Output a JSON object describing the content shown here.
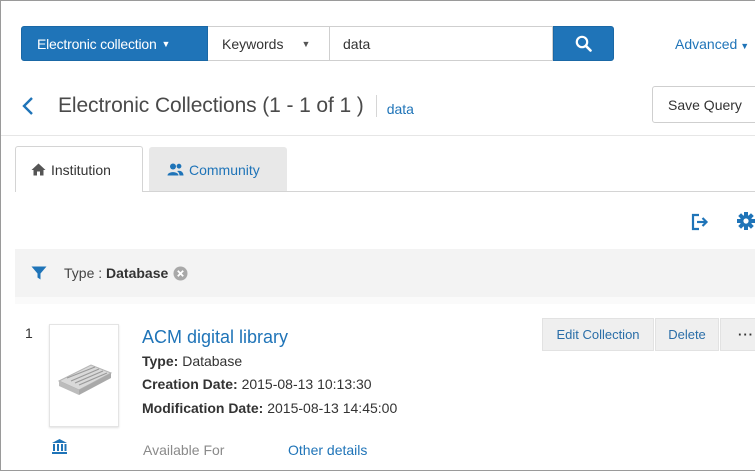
{
  "search": {
    "scope_label": "Electronic collection",
    "field_label": "Keywords",
    "query_value": "data",
    "advanced_label": "Advanced"
  },
  "header": {
    "title": "Electronic Collections (1 - 1 of 1 )",
    "query_tag": "data",
    "save_query_label": "Save Query"
  },
  "tabs": [
    {
      "label": "Institution",
      "icon": "home-icon",
      "active": true
    },
    {
      "label": "Community",
      "icon": "users-icon",
      "active": false
    }
  ],
  "filter": {
    "label": "Type : ",
    "value": "Database"
  },
  "result": {
    "index": "1",
    "title": "ACM digital library",
    "type_label": "Type:",
    "type_value": " Database",
    "created_label": "Creation Date:",
    "created_value": " 2015-08-13 10:13:30",
    "modified_label": "Modification Date:",
    "modified_value": " 2015-08-13 14:45:00",
    "available_for": "Available For",
    "other_details": "Other details",
    "actions": {
      "edit": "Edit Collection",
      "delete": "Delete",
      "more": "···"
    }
  },
  "colors": {
    "primary": "#1f74b8",
    "filter_bg": "#f3f3f3",
    "action_bg": "#efefef"
  }
}
